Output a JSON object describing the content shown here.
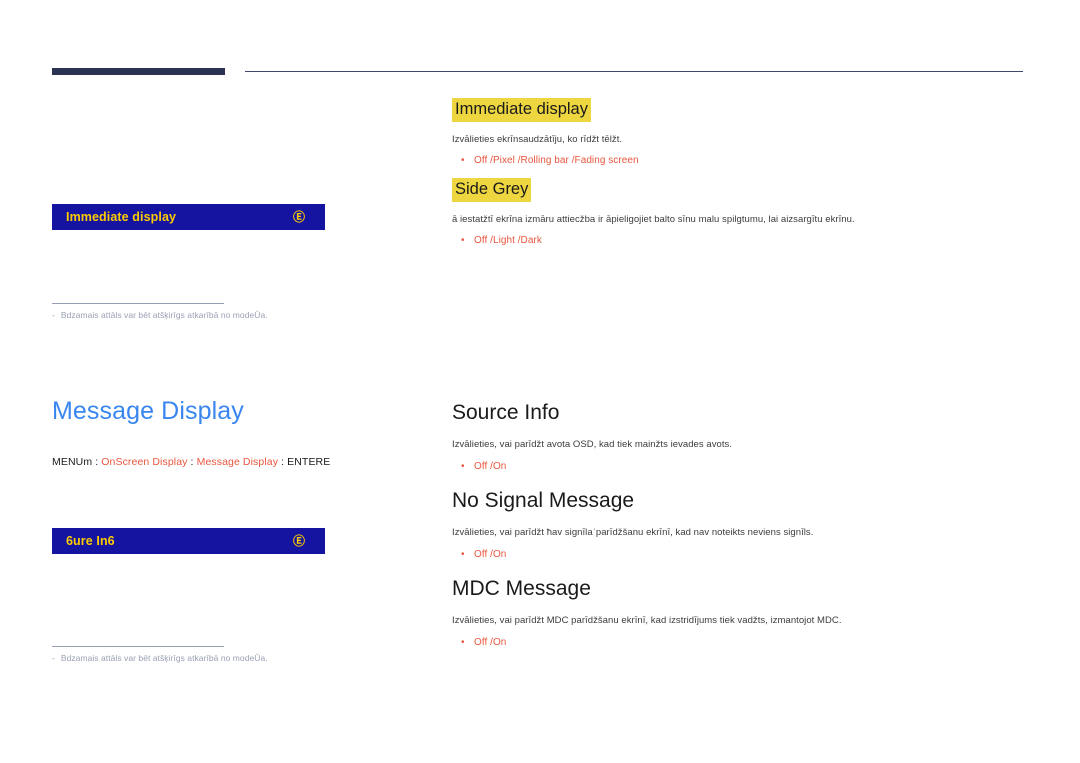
{
  "page": {
    "top_rule": "decorative-rule"
  },
  "left_column": {
    "panel_one": {
      "osd": {
        "title": "Immediate display",
        "icon": "circled-enter-icon",
        "icon_glyph": "Ⓔ"
      },
      "footnote": {
        "dash": "-",
        "text": "Bdzamais attāls var bēt atšķirīgs atkarībā no modeŬa."
      }
    },
    "section": {
      "heading": "Message Display",
      "breadcrumb": {
        "menu_label": "MENUm",
        "sep1": ":",
        "crumb1": "OnScreen Display",
        "sep2": ":",
        "crumb2": "Message Display",
        "sep3": ":",
        "enter_label": "ENTERE"
      }
    },
    "panel_two": {
      "osd": {
        "title": "6ure In6",
        "icon": "circled-enter-icon",
        "icon_glyph": "Ⓔ"
      },
      "footnote": {
        "dash": "-",
        "text": "Bdzamais attāls var bēt atšķirīgs atkarībā no modeŬa."
      }
    }
  },
  "right_column": {
    "topics": [
      {
        "title": "Immediate display",
        "highlighted": true,
        "desc": "Izvālieties ekrīnsaudzātīju, ko rīdžt tēlžt.",
        "bullet": "•",
        "options": "Off /Pixel /Rolling bar /Fading screen"
      },
      {
        "title": "Side Grey",
        "highlighted": true,
        "desc": "ā iestatžtī ekrīna izmāru attiecžba ir āpieligojiet balto sīnu malu spilgtumu, lai aizsargītu ekrīnu.",
        "bullet": "•",
        "options": "Off /Light /Dark"
      },
      {
        "title": "Source Info",
        "highlighted": false,
        "desc": "Izvālieties, vai parīdžt avota OSD, kad tiek mainžts ievades avots.",
        "bullet": "•",
        "options": "Off /On"
      },
      {
        "title": "No Signal Message",
        "highlighted": false,
        "desc": "Izvālieties, vai parīdžt ħav signīlaˈparīdžšanu ekrīnī, kad nav noteikts neviens signīls.",
        "bullet": "•",
        "options": "Off /On"
      },
      {
        "title": "MDC Message",
        "highlighted": false,
        "desc": "Izvālieties, vai parīdžt MDC parīdžšanu ekrīnī, kad izstridījums tiek vadžts, izmantojot MDC.",
        "bullet": "•",
        "options": "Off /On"
      }
    ]
  },
  "colors": {
    "heading_blue": "#3a86f0",
    "option_red": "#e8573f",
    "highlight_yellow": "#edd640",
    "osd_blue": "#1414a0",
    "osd_yellow": "#ffcc00",
    "rule_navy": "#2b3352"
  }
}
